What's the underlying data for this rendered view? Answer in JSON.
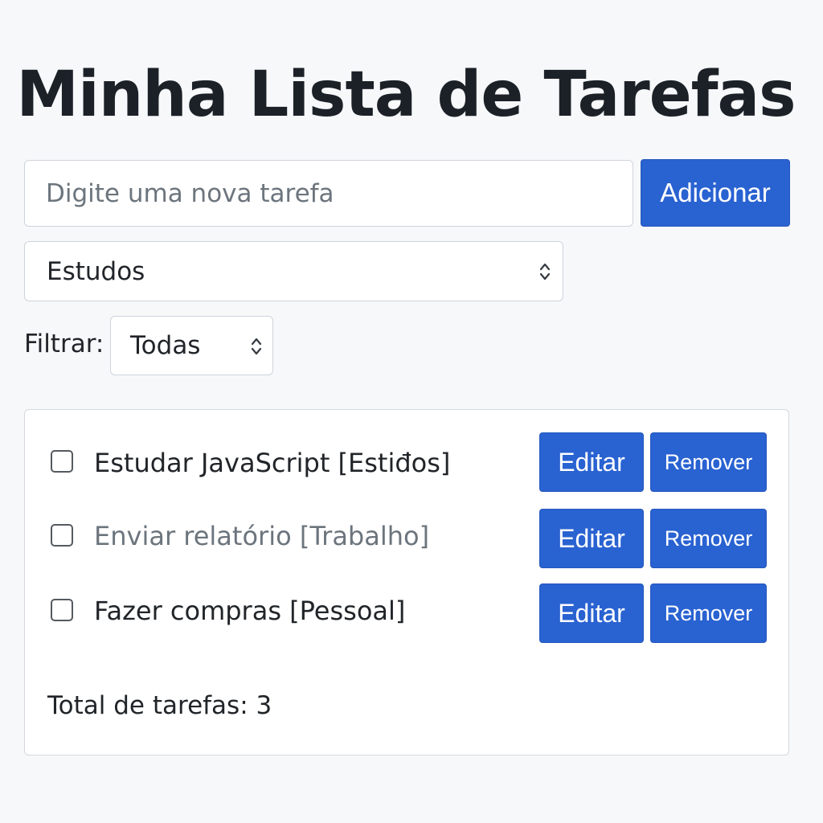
{
  "header": {
    "title": "Minha Lista de Tarefas"
  },
  "new_task": {
    "placeholder": "Digite uma nova tarefa",
    "value": "",
    "add_label": "Adicionar"
  },
  "category": {
    "selected": "Estudos"
  },
  "filter": {
    "label": "Filtrar:",
    "selected": "Todas"
  },
  "tasks": [
    {
      "text": "Estudar JavaScript [Estiđos]",
      "edit_label": "Editar",
      "remove_label": "Remover"
    },
    {
      "text": "Enviar relatório [Trabalho]",
      "edit_label": "Editar",
      "remove_label": "Remover"
    },
    {
      "text": "Fazer compras [Pessoal]",
      "edit_label": "Editar",
      "remove_label": "Remover"
    }
  ],
  "summary": {
    "total_text": "Total de tarefas: 3"
  },
  "colors": {
    "primary_button": "#2962d1",
    "background": "#f7f8fa",
    "muted_text": "#6c757d"
  },
  "icons": {
    "select_arrow": "chevron-up-down-icon"
  }
}
